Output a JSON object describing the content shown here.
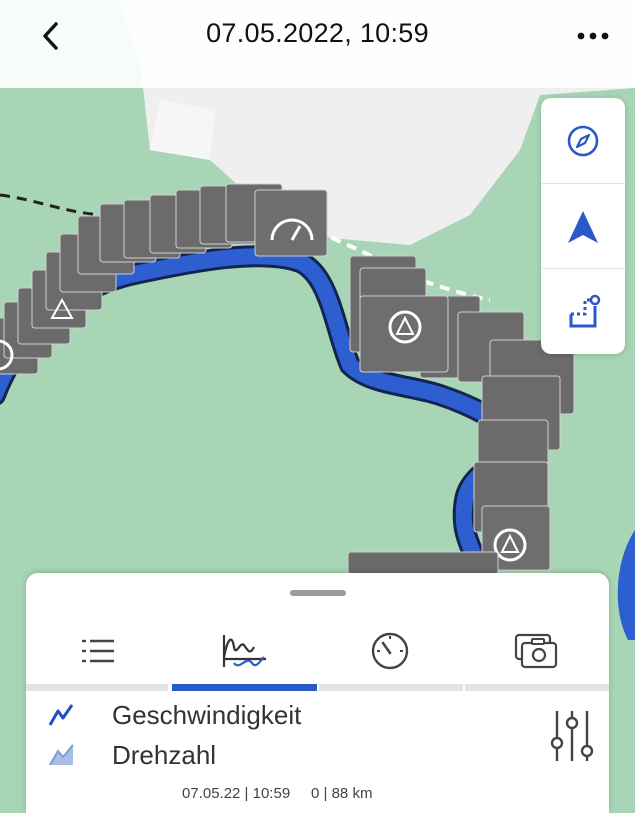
{
  "header": {
    "title": "07.05.2022, 10:59",
    "back_icon": "chevron-left-icon",
    "more_icon": "more-horizontal-icon"
  },
  "map_controls": [
    {
      "name": "compass-icon"
    },
    {
      "name": "navigation-arrow-icon"
    },
    {
      "name": "route-overview-icon"
    }
  ],
  "panel": {
    "tabs": [
      {
        "icon": "list-icon",
        "active": false
      },
      {
        "icon": "chart-icon",
        "active": true
      },
      {
        "icon": "speedometer-icon",
        "active": false
      },
      {
        "icon": "camera-gallery-icon",
        "active": false
      }
    ],
    "legend": [
      {
        "label": "Geschwindigkeit",
        "icon": "line-series-icon"
      },
      {
        "label": "Drehzahl",
        "icon": "area-series-icon"
      }
    ],
    "footer": {
      "date": "07.05.22 | 10:59",
      "distance": "0 | 88 km"
    }
  },
  "colors": {
    "accent": "#2a59c9",
    "route": "#2d5fd0",
    "map_green": "#a8d5b6"
  }
}
